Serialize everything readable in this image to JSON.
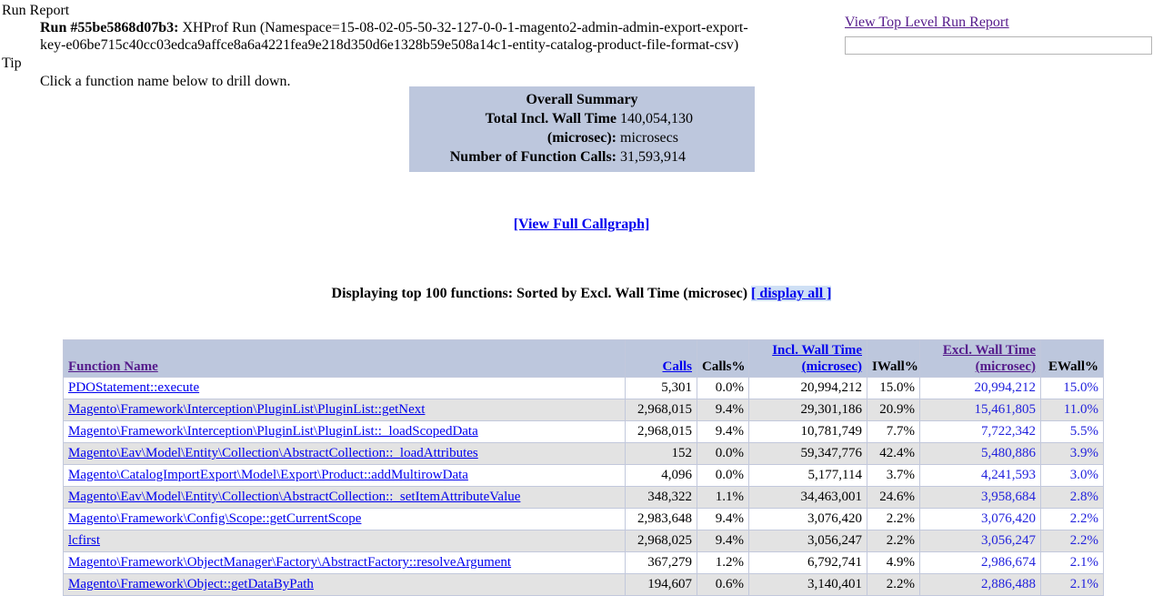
{
  "header": {
    "run_report_label": "Run Report",
    "run_id_label": "Run #55be5868d07b3:",
    "run_description": "XHProf Run (Namespace=15-08-02-05-50-32-127-0-0-1-magento2-admin-admin-export-export-key-e06be715c40cc03edca9affce8a6a4221fea9e218d350d6e1328b59e508a14c1-entity-catalog-product-file-format-csv)",
    "tip_label": "Tip",
    "tip_text": "Click a function name below to drill down.",
    "top_level_link": "View Top Level Run Report",
    "search_value": "",
    "search_placeholder": ""
  },
  "summary": {
    "title": "Overall Summary",
    "rows": [
      {
        "key": "Total Incl. Wall Time (microsec):",
        "value": "140,054,130 microsecs"
      },
      {
        "key": "Number of Function Calls:",
        "value": "31,593,914"
      }
    ],
    "total_wall_time_key": "Total Incl. Wall Time",
    "total_wall_time_key2": "(microsec):",
    "total_wall_time_value": "140,054,130",
    "total_wall_time_value2": "microsecs",
    "num_calls_key": "Number of Function Calls:",
    "num_calls_value": "31,593,914"
  },
  "callgraph_link": "[View Full Callgraph]",
  "displaying": {
    "text": "Displaying top 100 functions: Sorted by Excl. Wall Time (microsec)",
    "display_all_link": "[ display all ]"
  },
  "table": {
    "columns": [
      {
        "label": "Function Name",
        "link": true,
        "visited": false,
        "align": "left"
      },
      {
        "label": "Calls",
        "link": true,
        "visited": false,
        "align": "right"
      },
      {
        "label": "Calls%",
        "link": false,
        "visited": false,
        "align": "right"
      },
      {
        "label": "Incl. Wall Time (microsec)",
        "link": true,
        "visited": false,
        "align": "right"
      },
      {
        "label": "IWall%",
        "link": false,
        "visited": false,
        "align": "right"
      },
      {
        "label": "Excl. Wall Time (microsec)",
        "link": true,
        "visited": true,
        "align": "right"
      },
      {
        "label": "EWall%",
        "link": false,
        "visited": false,
        "align": "right"
      }
    ],
    "col_labels": {
      "function_name": "Function Name",
      "calls": "Calls",
      "calls_pct": "Calls%",
      "incl_wall_1": "Incl. Wall Time",
      "incl_wall_2": "(microsec)",
      "iwall_pct": "IWall%",
      "excl_wall_1": "Excl. Wall Time",
      "excl_wall_2": "(microsec)",
      "ewall_pct": "EWall%"
    },
    "rows": [
      {
        "function": "PDOStatement::execute",
        "calls": "5,301",
        "calls_pct": "0.0%",
        "incl_wall": "20,994,212",
        "iwall_pct": "15.0%",
        "excl_wall": "20,994,212",
        "ewall_pct": "15.0%"
      },
      {
        "function": "Magento\\Framework\\Interception\\PluginList\\PluginList::getNext",
        "calls": "2,968,015",
        "calls_pct": "9.4%",
        "incl_wall": "29,301,186",
        "iwall_pct": "20.9%",
        "excl_wall": "15,461,805",
        "ewall_pct": "11.0%"
      },
      {
        "function": "Magento\\Framework\\Interception\\PluginList\\PluginList::_loadScopedData",
        "calls": "2,968,015",
        "calls_pct": "9.4%",
        "incl_wall": "10,781,749",
        "iwall_pct": "7.7%",
        "excl_wall": "7,722,342",
        "ewall_pct": "5.5%"
      },
      {
        "function": "Magento\\Eav\\Model\\Entity\\Collection\\AbstractCollection::_loadAttributes",
        "calls": "152",
        "calls_pct": "0.0%",
        "incl_wall": "59,347,776",
        "iwall_pct": "42.4%",
        "excl_wall": "5,480,886",
        "ewall_pct": "3.9%"
      },
      {
        "function": "Magento\\CatalogImportExport\\Model\\Export\\Product::addMultirowData",
        "calls": "4,096",
        "calls_pct": "0.0%",
        "incl_wall": "5,177,114",
        "iwall_pct": "3.7%",
        "excl_wall": "4,241,593",
        "ewall_pct": "3.0%"
      },
      {
        "function": "Magento\\Eav\\Model\\Entity\\Collection\\AbstractCollection::_setItemAttributeValue",
        "calls": "348,322",
        "calls_pct": "1.1%",
        "incl_wall": "34,463,001",
        "iwall_pct": "24.6%",
        "excl_wall": "3,958,684",
        "ewall_pct": "2.8%"
      },
      {
        "function": "Magento\\Framework\\Config\\Scope::getCurrentScope",
        "calls": "2,983,648",
        "calls_pct": "9.4%",
        "incl_wall": "3,076,420",
        "iwall_pct": "2.2%",
        "excl_wall": "3,076,420",
        "ewall_pct": "2.2%"
      },
      {
        "function": "lcfirst",
        "calls": "2,968,025",
        "calls_pct": "9.4%",
        "incl_wall": "3,056,247",
        "iwall_pct": "2.2%",
        "excl_wall": "3,056,247",
        "ewall_pct": "2.2%"
      },
      {
        "function": "Magento\\Framework\\ObjectManager\\Factory\\AbstractFactory::resolveArgument",
        "calls": "367,279",
        "calls_pct": "1.2%",
        "incl_wall": "6,792,741",
        "iwall_pct": "4.9%",
        "excl_wall": "2,986,674",
        "ewall_pct": "2.1%"
      },
      {
        "function": "Magento\\Framework\\Object::getDataByPath",
        "calls": "194,607",
        "calls_pct": "0.6%",
        "incl_wall": "3,140,401",
        "iwall_pct": "2.2%",
        "excl_wall": "2,886,488",
        "ewall_pct": "2.1%"
      }
    ]
  },
  "colors": {
    "header_bg": "#bdc7dd",
    "row_alt_bg": "#e3e3e3",
    "link": "#0000ee",
    "visited_link": "#551a8b",
    "sorted_col_text": "#2222dd",
    "highlight_bg": "#cfe0f5"
  }
}
